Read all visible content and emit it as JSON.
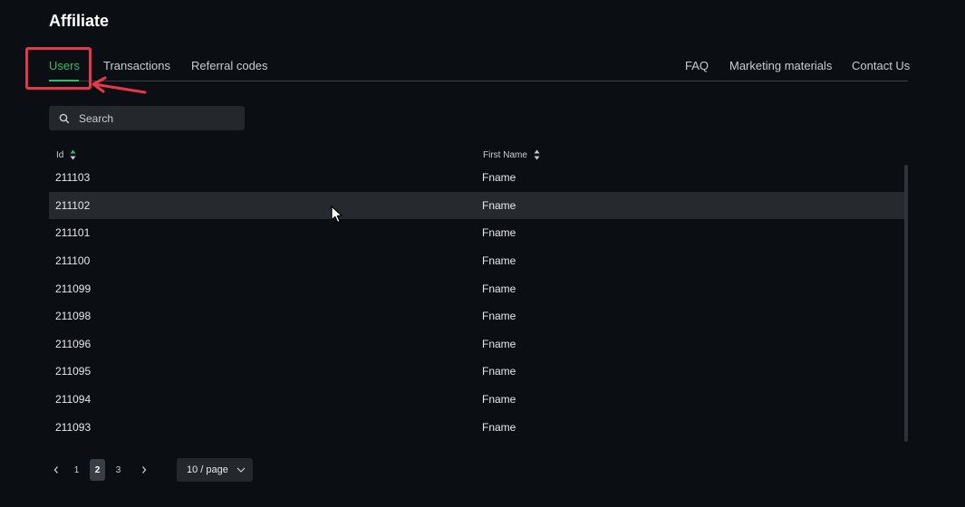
{
  "page": {
    "title": "Affiliate"
  },
  "tabs": {
    "left": [
      {
        "label": "Users",
        "active": true
      },
      {
        "label": "Transactions",
        "active": false
      },
      {
        "label": "Referral codes",
        "active": false
      }
    ],
    "right": [
      {
        "label": "FAQ"
      },
      {
        "label": "Marketing materials"
      },
      {
        "label": "Contact Us"
      }
    ]
  },
  "search": {
    "placeholder": "Search",
    "value": ""
  },
  "table": {
    "columns": [
      {
        "label": "Id"
      },
      {
        "label": "First Name"
      }
    ],
    "rows": [
      {
        "id": "211103",
        "first_name": "Fname"
      },
      {
        "id": "211102",
        "first_name": "Fname"
      },
      {
        "id": "211101",
        "first_name": "Fname"
      },
      {
        "id": "211100",
        "first_name": "Fname"
      },
      {
        "id": "211099",
        "first_name": "Fname"
      },
      {
        "id": "211098",
        "first_name": "Fname"
      },
      {
        "id": "211096",
        "first_name": "Fname"
      },
      {
        "id": "211095",
        "first_name": "Fname"
      },
      {
        "id": "211094",
        "first_name": "Fname"
      },
      {
        "id": "211093",
        "first_name": "Fname"
      }
    ],
    "hovered_row": 1
  },
  "pagination": {
    "pages": [
      "1",
      "2",
      "3"
    ],
    "current": "2",
    "page_size_label": "10 / page"
  },
  "colors": {
    "background": "#0b0f14",
    "accent": "#2ebd6e",
    "annotation": "#e5384a"
  },
  "icons": {
    "search": "search-icon",
    "sort": "sort-icon",
    "prev": "chevron-left-icon",
    "next": "chevron-right-icon",
    "page_size": "chevron-down-icon"
  }
}
